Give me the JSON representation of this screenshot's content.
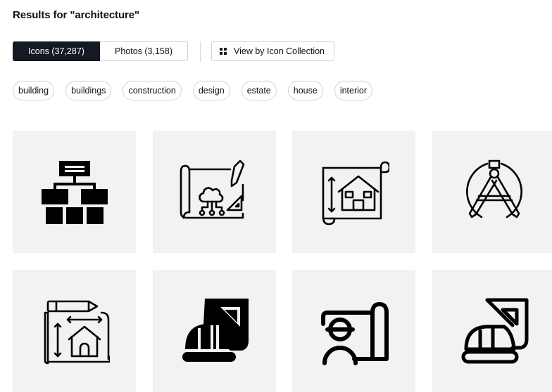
{
  "header": {
    "title": "Results for \"architecture\""
  },
  "filters": {
    "icons_tab": "Icons (37,287)",
    "photos_tab": "Photos (3,158)",
    "collection_button": "View by Icon Collection"
  },
  "tags": [
    "building",
    "buildings",
    "construction",
    "design",
    "estate",
    "house",
    "interior"
  ],
  "icons": [
    "org-chart-building-icon",
    "smart-house-blueprint-icon",
    "house-blueprint-icon",
    "compass-drafting-icon",
    "house-plan-pencil-icon",
    "helmet-ruler-solid-icon",
    "architect-worker-blueprint-icon",
    "helmet-ruler-outline-icon"
  ],
  "colors": {
    "active_tab": "#141923",
    "card_bg": "#f2f2f4",
    "icon": "#000000"
  }
}
